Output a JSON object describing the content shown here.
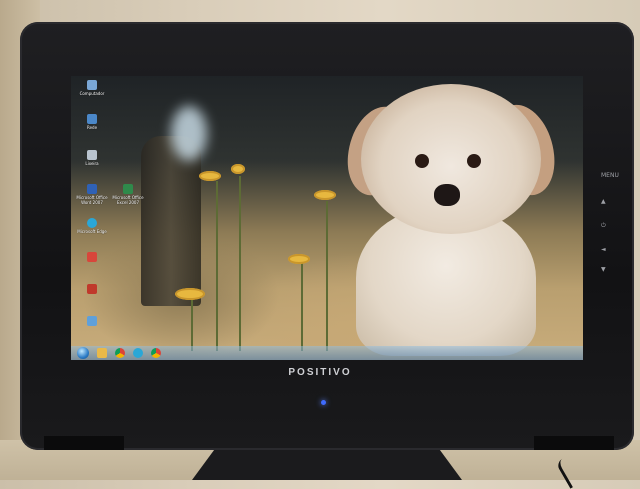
{
  "monitor": {
    "brand": "POSITIVO",
    "side_buttons": [
      "MENU",
      "▲",
      "⏻",
      "◄",
      "▼"
    ]
  },
  "desktop": {
    "icons": [
      {
        "label": "Computador",
        "icon": "computer-icon"
      },
      {
        "label": "Rede",
        "icon": "network-icon"
      },
      {
        "label": "Lixeira",
        "icon": "recycle-bin-icon"
      },
      {
        "label": "Microsoft Office Word 2007",
        "icon": "word-icon"
      },
      {
        "label": "Microsoft Office Excel 2007",
        "icon": "excel-icon"
      },
      {
        "label": "Microsoft Edge",
        "icon": "edge-icon"
      },
      {
        "label": "",
        "icon": "app-icon"
      },
      {
        "label": "",
        "icon": "app-icon-2"
      },
      {
        "label": "",
        "icon": "app-icon-3"
      }
    ],
    "gadget_text": "",
    "taskbar": {
      "pinned": [
        "explorer-icon",
        "chrome-icon",
        "edge-icon",
        "chrome-icon-2"
      ],
      "tray_time": "",
      "tray_date": ""
    }
  },
  "colors": {
    "bezel": "#141416",
    "led": "#3f6bff",
    "taskbar": "#6e9ac2"
  }
}
